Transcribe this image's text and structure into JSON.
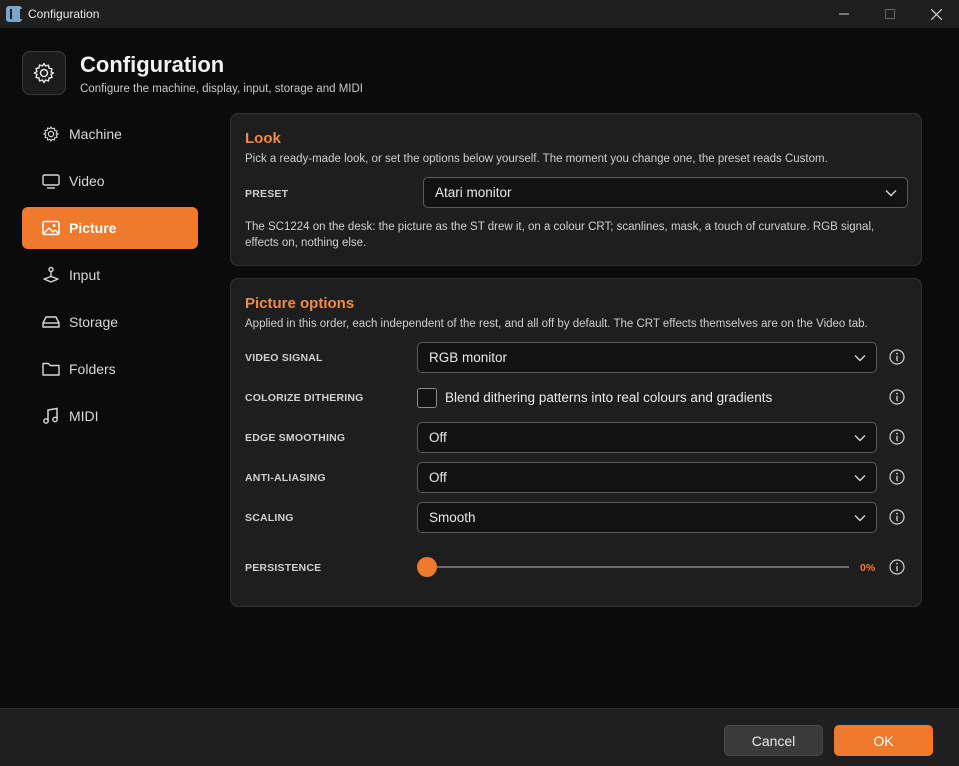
{
  "window": {
    "title": "Configuration",
    "controls": [
      "minimize-icon",
      "maximize-icon",
      "close-icon"
    ]
  },
  "header": {
    "icon": "gear-icon",
    "title": "Configuration",
    "subtitle": "Configure the machine, display, input, storage and MIDI"
  },
  "sidebar": {
    "items": [
      {
        "label": "Machine",
        "icon": "gear-icon",
        "active": false
      },
      {
        "label": "Video",
        "icon": "monitor-icon",
        "active": false
      },
      {
        "label": "Picture",
        "icon": "image-icon",
        "active": true
      },
      {
        "label": "Input",
        "icon": "joystick-icon",
        "active": false
      },
      {
        "label": "Storage",
        "icon": "drive-icon",
        "active": false
      },
      {
        "label": "Folders",
        "icon": "folder-icon",
        "active": false
      },
      {
        "label": "MIDI",
        "icon": "music-note-icon",
        "active": false
      }
    ]
  },
  "look": {
    "title": "Look",
    "description": "Pick a ready-made look, or set the options below yourself. The moment you change one, the preset reads Custom.",
    "preset_label": "PRESET",
    "preset_value": "Atari monitor",
    "preset_note": "The SC1224 on the desk: the picture as the ST drew it, on a colour CRT; scanlines, mask, a touch of curvature. RGB signal,",
    "preset_note2": "effects on, nothing else."
  },
  "options": {
    "title": "Picture options",
    "description": "Applied in this order, each independent of the rest, and all off by default. The CRT effects themselves are on the Video tab.",
    "video_signal": {
      "label": "VIDEO SIGNAL",
      "value": "RGB monitor"
    },
    "colorize": {
      "label": "COLORIZE DITHERING",
      "checkbox_label": "Blend dithering patterns into real colours and gradients",
      "checked": false
    },
    "edge_smoothing": {
      "label": "EDGE SMOOTHING",
      "value": "Off"
    },
    "anti_aliasing": {
      "label": "ANTI-ALIASING",
      "value": "Off"
    },
    "scaling": {
      "label": "SCALING",
      "value": "Smooth"
    },
    "persistence": {
      "label": "PERSISTENCE",
      "value_text": "0%",
      "value": 0
    }
  },
  "footer": {
    "cancel_label": "Cancel",
    "ok_label": "OK"
  },
  "colors": {
    "accent": "#f07a2c",
    "section_title": "#f28a45",
    "background": "#0b0b0b",
    "card": "#1e1e1e"
  }
}
